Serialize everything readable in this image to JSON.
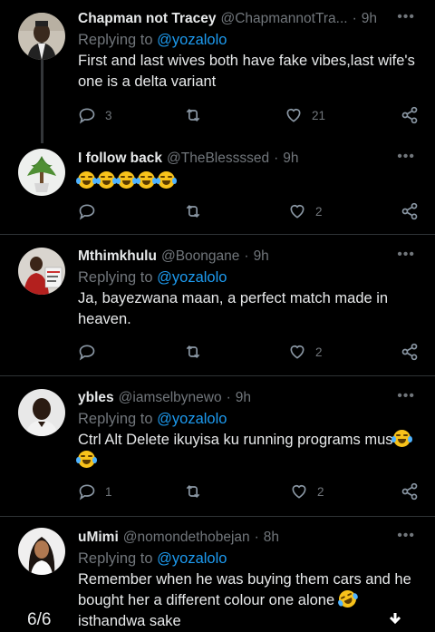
{
  "tweets": [
    {
      "name": "Chapman not Tracey",
      "handle": "@ChapmannotTra...",
      "sep": "·",
      "time": "9h",
      "replying_prefix": "Replying to ",
      "replying_to": "@yozalolo",
      "text": "First and last wives both have fake vibes,last wife's one is a delta variant",
      "replies": "3",
      "retweets": "",
      "likes": "21"
    },
    {
      "name": "I follow back",
      "handle": "@TheBlessssed",
      "sep": "·",
      "time": "9h",
      "text_emojis": 5,
      "replies": "",
      "retweets": "",
      "likes": "2"
    },
    {
      "name": "Mthimkhulu",
      "handle": "@Boongane",
      "sep": "·",
      "time": "9h",
      "replying_prefix": "Replying to ",
      "replying_to": "@yozalolo",
      "text": "Ja, bayezwana maan, a perfect match made in heaven.",
      "replies": "",
      "retweets": "",
      "likes": "2"
    },
    {
      "name": "ybles",
      "handle": "@iamselbynewo",
      "sep": "·",
      "time": "9h",
      "replying_prefix": "Replying to ",
      "replying_to": "@yozalolo",
      "text": "Ctrl Alt Delete ikuyisa ku running programs mus",
      "replies": "1",
      "retweets": "",
      "likes": "2"
    },
    {
      "name": "uMimi",
      "handle": "@nomondethobejan",
      "sep": "·",
      "time": "8h",
      "replying_prefix": "Replying to ",
      "replying_to": "@yozalolo",
      "text_line1": "Remember when he was buying them cars and he",
      "text_line2": "bought her a different colour one alone",
      "text_line3": "isthandwa sake"
    }
  ],
  "more_label": "•••",
  "page_counter": "6/6",
  "icons": {
    "reply": "reply-icon",
    "retweet": "retweet-icon",
    "like": "heart-icon",
    "share": "share-icon",
    "more": "more-icon",
    "download": "download-icon"
  },
  "colors": {
    "background": "#000000",
    "text": "#e7e9ea",
    "muted": "#71767b",
    "mention": "#1d9bf0",
    "divider": "#2f3336"
  }
}
